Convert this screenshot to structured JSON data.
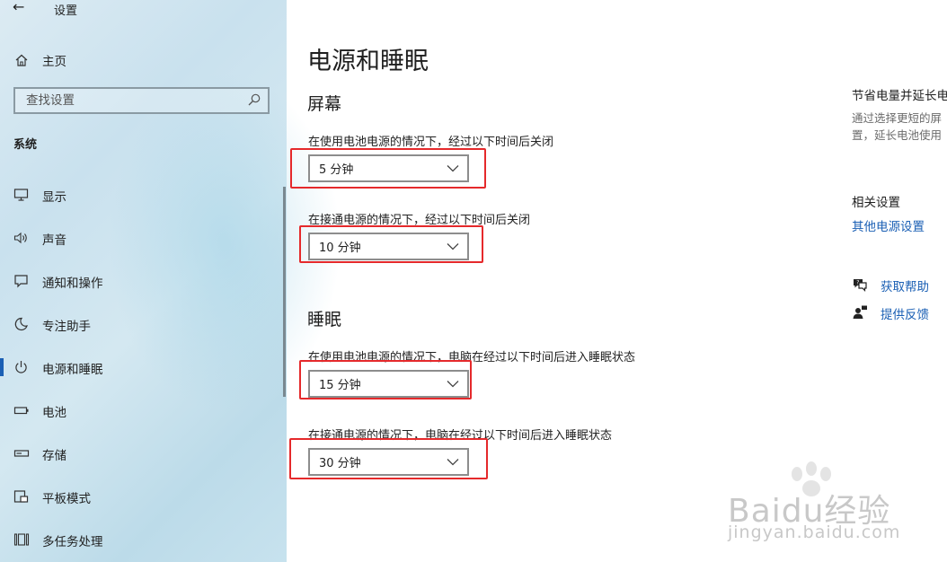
{
  "app": {
    "title": "设置"
  },
  "sidebar": {
    "home_label": "主页",
    "search": {
      "placeholder": "查找设置"
    },
    "section_label": "系统",
    "items": [
      {
        "label": "显示",
        "icon": "display-icon"
      },
      {
        "label": "声音",
        "icon": "speaker-icon"
      },
      {
        "label": "通知和操作",
        "icon": "notification-icon"
      },
      {
        "label": "专注助手",
        "icon": "moon-icon"
      },
      {
        "label": "电源和睡眠",
        "icon": "power-icon",
        "active": true
      },
      {
        "label": "电池",
        "icon": "battery-icon"
      },
      {
        "label": "存储",
        "icon": "storage-icon"
      },
      {
        "label": "平板模式",
        "icon": "tablet-icon"
      },
      {
        "label": "多任务处理",
        "icon": "multitask-icon"
      }
    ]
  },
  "main": {
    "title": "电源和睡眠",
    "screen": {
      "heading": "屏幕",
      "battery_label": "在使用电池电源的情况下，经过以下时间后关闭",
      "battery_value": "5 分钟",
      "plugged_label": "在接通电源的情况下，经过以下时间后关闭",
      "plugged_value": "10 分钟"
    },
    "sleep": {
      "heading": "睡眠",
      "battery_label": "在使用电池电源的情况下，电脑在经过以下时间后进入睡眠状态",
      "battery_value": "15 分钟",
      "plugged_label": "在接通电源的情况下，电脑在经过以下时间后进入睡眠状态",
      "plugged_value": "30 分钟"
    }
  },
  "right_panel": {
    "tip_title": "节省电量并延长电",
    "tip_desc_line1": "通过选择更短的屏",
    "tip_desc_line2": "置，延长电池使用",
    "related_title": "相关设置",
    "related_link": "其他电源设置",
    "help_link": "获取帮助",
    "feedback_link": "提供反馈"
  },
  "watermark": {
    "brand": "Baidu经验",
    "url": "jingyan.baidu.com"
  },
  "colors": {
    "accent": "#1a5fb4",
    "highlight": "#e5292b",
    "sidebar_bg": "#cfe5f0"
  }
}
